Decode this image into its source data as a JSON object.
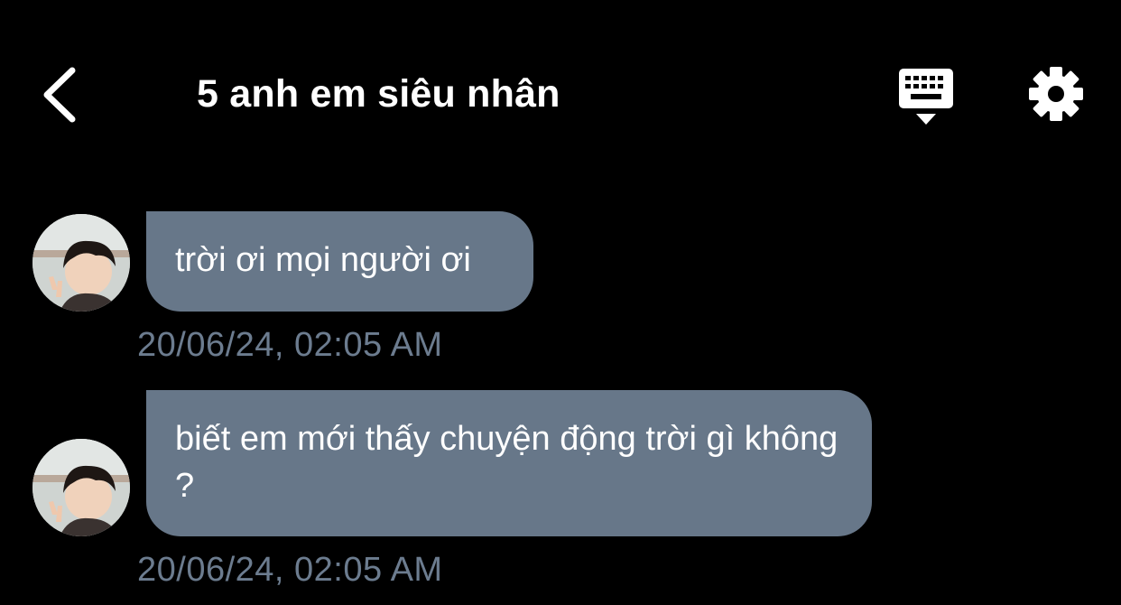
{
  "header": {
    "title": "5 anh em siêu nhân",
    "back_icon": "chevron-left-icon",
    "keyboard_icon": "keyboard-hide-icon",
    "settings_icon": "gear-icon"
  },
  "colors": {
    "background": "#000000",
    "bubble": "#677789",
    "timestamp": "#6c7c8f",
    "text": "#ffffff"
  },
  "messages": [
    {
      "text": "trời ơi mọi người ơi",
      "timestamp": "20/06/24, 02:05 AM"
    },
    {
      "text": "biết em mới thấy chuyện động trời gì không ?",
      "timestamp": "20/06/24, 02:05 AM"
    }
  ]
}
